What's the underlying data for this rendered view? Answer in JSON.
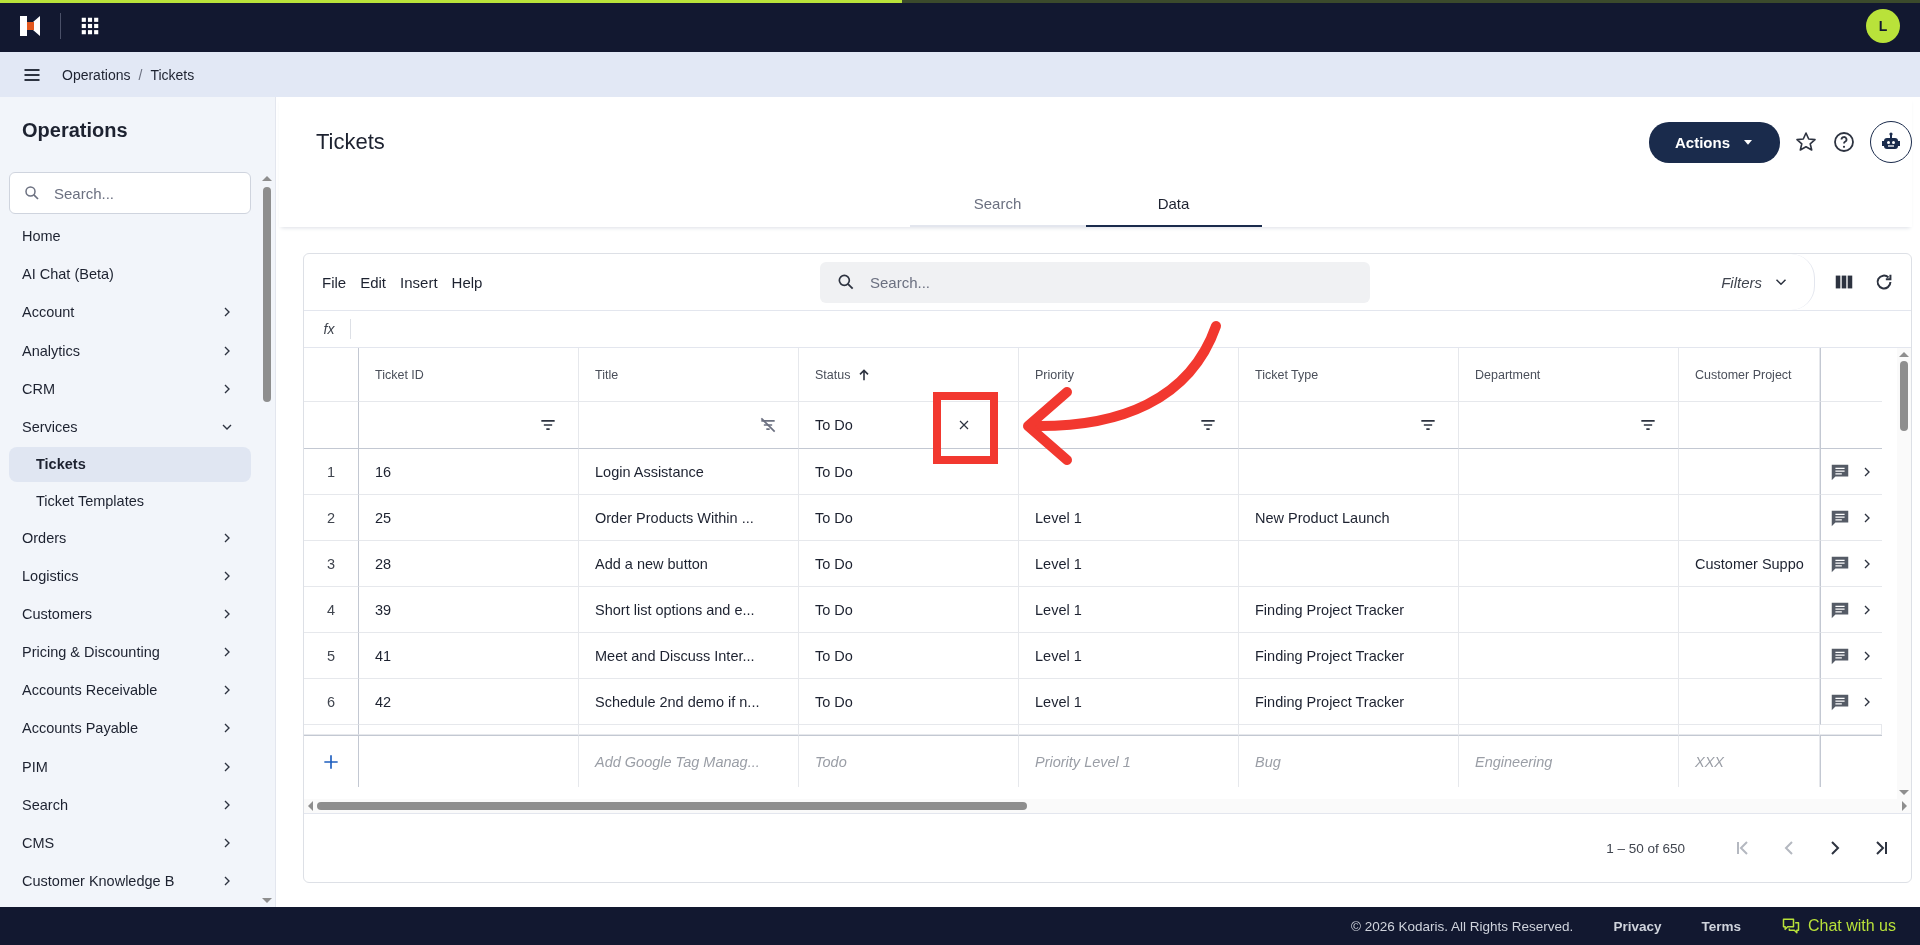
{
  "top_bar": {
    "progress": {
      "level": 0.47
    },
    "avatar": "L"
  },
  "breadcrumb": {
    "separator": "/",
    "items": [
      "Operations",
      "Tickets"
    ]
  },
  "sidebar": {
    "title": "Operations",
    "search_placeholder": "Search...",
    "items": [
      {
        "label": "Home",
        "kind": "link",
        "selected": false
      },
      {
        "label": "AI Chat (Beta)",
        "kind": "link",
        "selected": false
      },
      {
        "label": "Account",
        "kind": "group",
        "expanded": false,
        "selected": false
      },
      {
        "label": "Analytics",
        "kind": "group",
        "expanded": false,
        "selected": false
      },
      {
        "label": "CRM",
        "kind": "group",
        "expanded": false,
        "selected": false
      },
      {
        "label": "Services",
        "kind": "group",
        "expanded": true,
        "selected": false,
        "children": [
          {
            "label": "Tickets",
            "selected": true
          },
          {
            "label": "Ticket Templates",
            "selected": false
          }
        ]
      },
      {
        "label": "Orders",
        "kind": "group",
        "expanded": false,
        "selected": false
      },
      {
        "label": "Logistics",
        "kind": "group",
        "expanded": false,
        "selected": false
      },
      {
        "label": "Customers",
        "kind": "group",
        "expanded": false,
        "selected": false
      },
      {
        "label": "Pricing & Discounting",
        "kind": "group",
        "expanded": false,
        "selected": false
      },
      {
        "label": "Accounts Receivable",
        "kind": "group",
        "expanded": false,
        "selected": false
      },
      {
        "label": "Accounts Payable",
        "kind": "group",
        "expanded": false,
        "selected": false
      },
      {
        "label": "PIM",
        "kind": "group",
        "expanded": false,
        "selected": false
      },
      {
        "label": "Search",
        "kind": "group",
        "expanded": false,
        "selected": false
      },
      {
        "label": "CMS",
        "kind": "group",
        "expanded": false,
        "selected": false
      },
      {
        "label": "Customer Knowledge B",
        "kind": "group",
        "expanded": false,
        "selected": false
      }
    ]
  },
  "page": {
    "title": "Tickets",
    "actions_button": "Actions",
    "tabs": [
      {
        "label": "Search",
        "selected": false
      },
      {
        "label": "Data",
        "selected": true
      }
    ]
  },
  "grid": {
    "menu": [
      "File",
      "Edit",
      "Insert",
      "Help"
    ],
    "search_placeholder": "Search...",
    "filters_label": "Filters",
    "formula_label": "fx",
    "columns": [
      {
        "label": "Ticket ID",
        "sorted": false,
        "kind": "filterable",
        "filter_enabled": true
      },
      {
        "label": "Title",
        "sorted": false,
        "kind": "filterable",
        "filter_enabled": false
      },
      {
        "label": "Status",
        "sorted": true,
        "kind": "filterable",
        "filter_value": "To Do"
      },
      {
        "label": "Priority",
        "sorted": false,
        "kind": "filterable",
        "filter_enabled": true
      },
      {
        "label": "Ticket Type",
        "sorted": false,
        "kind": "filterable",
        "filter_enabled": true
      },
      {
        "label": "Department",
        "sorted": false,
        "kind": "filterable",
        "filter_enabled": true
      },
      {
        "label": "Customer Project",
        "sorted": false,
        "kind": "plain"
      }
    ],
    "rows": [
      {
        "number": "1",
        "cells": [
          "16",
          "Login Assistance",
          "To Do",
          null,
          null,
          null,
          null
        ]
      },
      {
        "number": "2",
        "cells": [
          "25",
          "Order Products Within ...",
          "To Do",
          "Level 1",
          "New Product Launch",
          null,
          null
        ]
      },
      {
        "number": "3",
        "cells": [
          "28",
          "Add a new button",
          "To Do",
          "Level 1",
          null,
          null,
          "Customer Suppo"
        ]
      },
      {
        "number": "4",
        "cells": [
          "39",
          "Short list options and e...",
          "To Do",
          "Level 1",
          "Finding Project Tracker",
          null,
          null
        ]
      },
      {
        "number": "5",
        "cells": [
          "41",
          "Meet and Discuss Inter...",
          "To Do",
          "Level 1",
          "Finding Project Tracker",
          null,
          null
        ]
      },
      {
        "number": "6",
        "cells": [
          "42",
          "Schedule 2nd demo if n...",
          "To Do",
          "Level 1",
          "Finding Project Tracker",
          null,
          null
        ]
      }
    ],
    "new_row": [
      "Add Google Tag Manag...",
      "Todo",
      "Priority Level 1",
      "Bug",
      "Engineering",
      "XXX"
    ],
    "pagination": {
      "range": "1 – 50 of 650",
      "first_disabled": true,
      "prev_disabled": true,
      "next_disabled": false,
      "last_disabled": false
    }
  },
  "footer": {
    "copyright": "© 2026 Kodaris. All Rights Reserved.",
    "links": [
      "Privacy",
      "Terms"
    ],
    "chat": "Chat with us"
  }
}
